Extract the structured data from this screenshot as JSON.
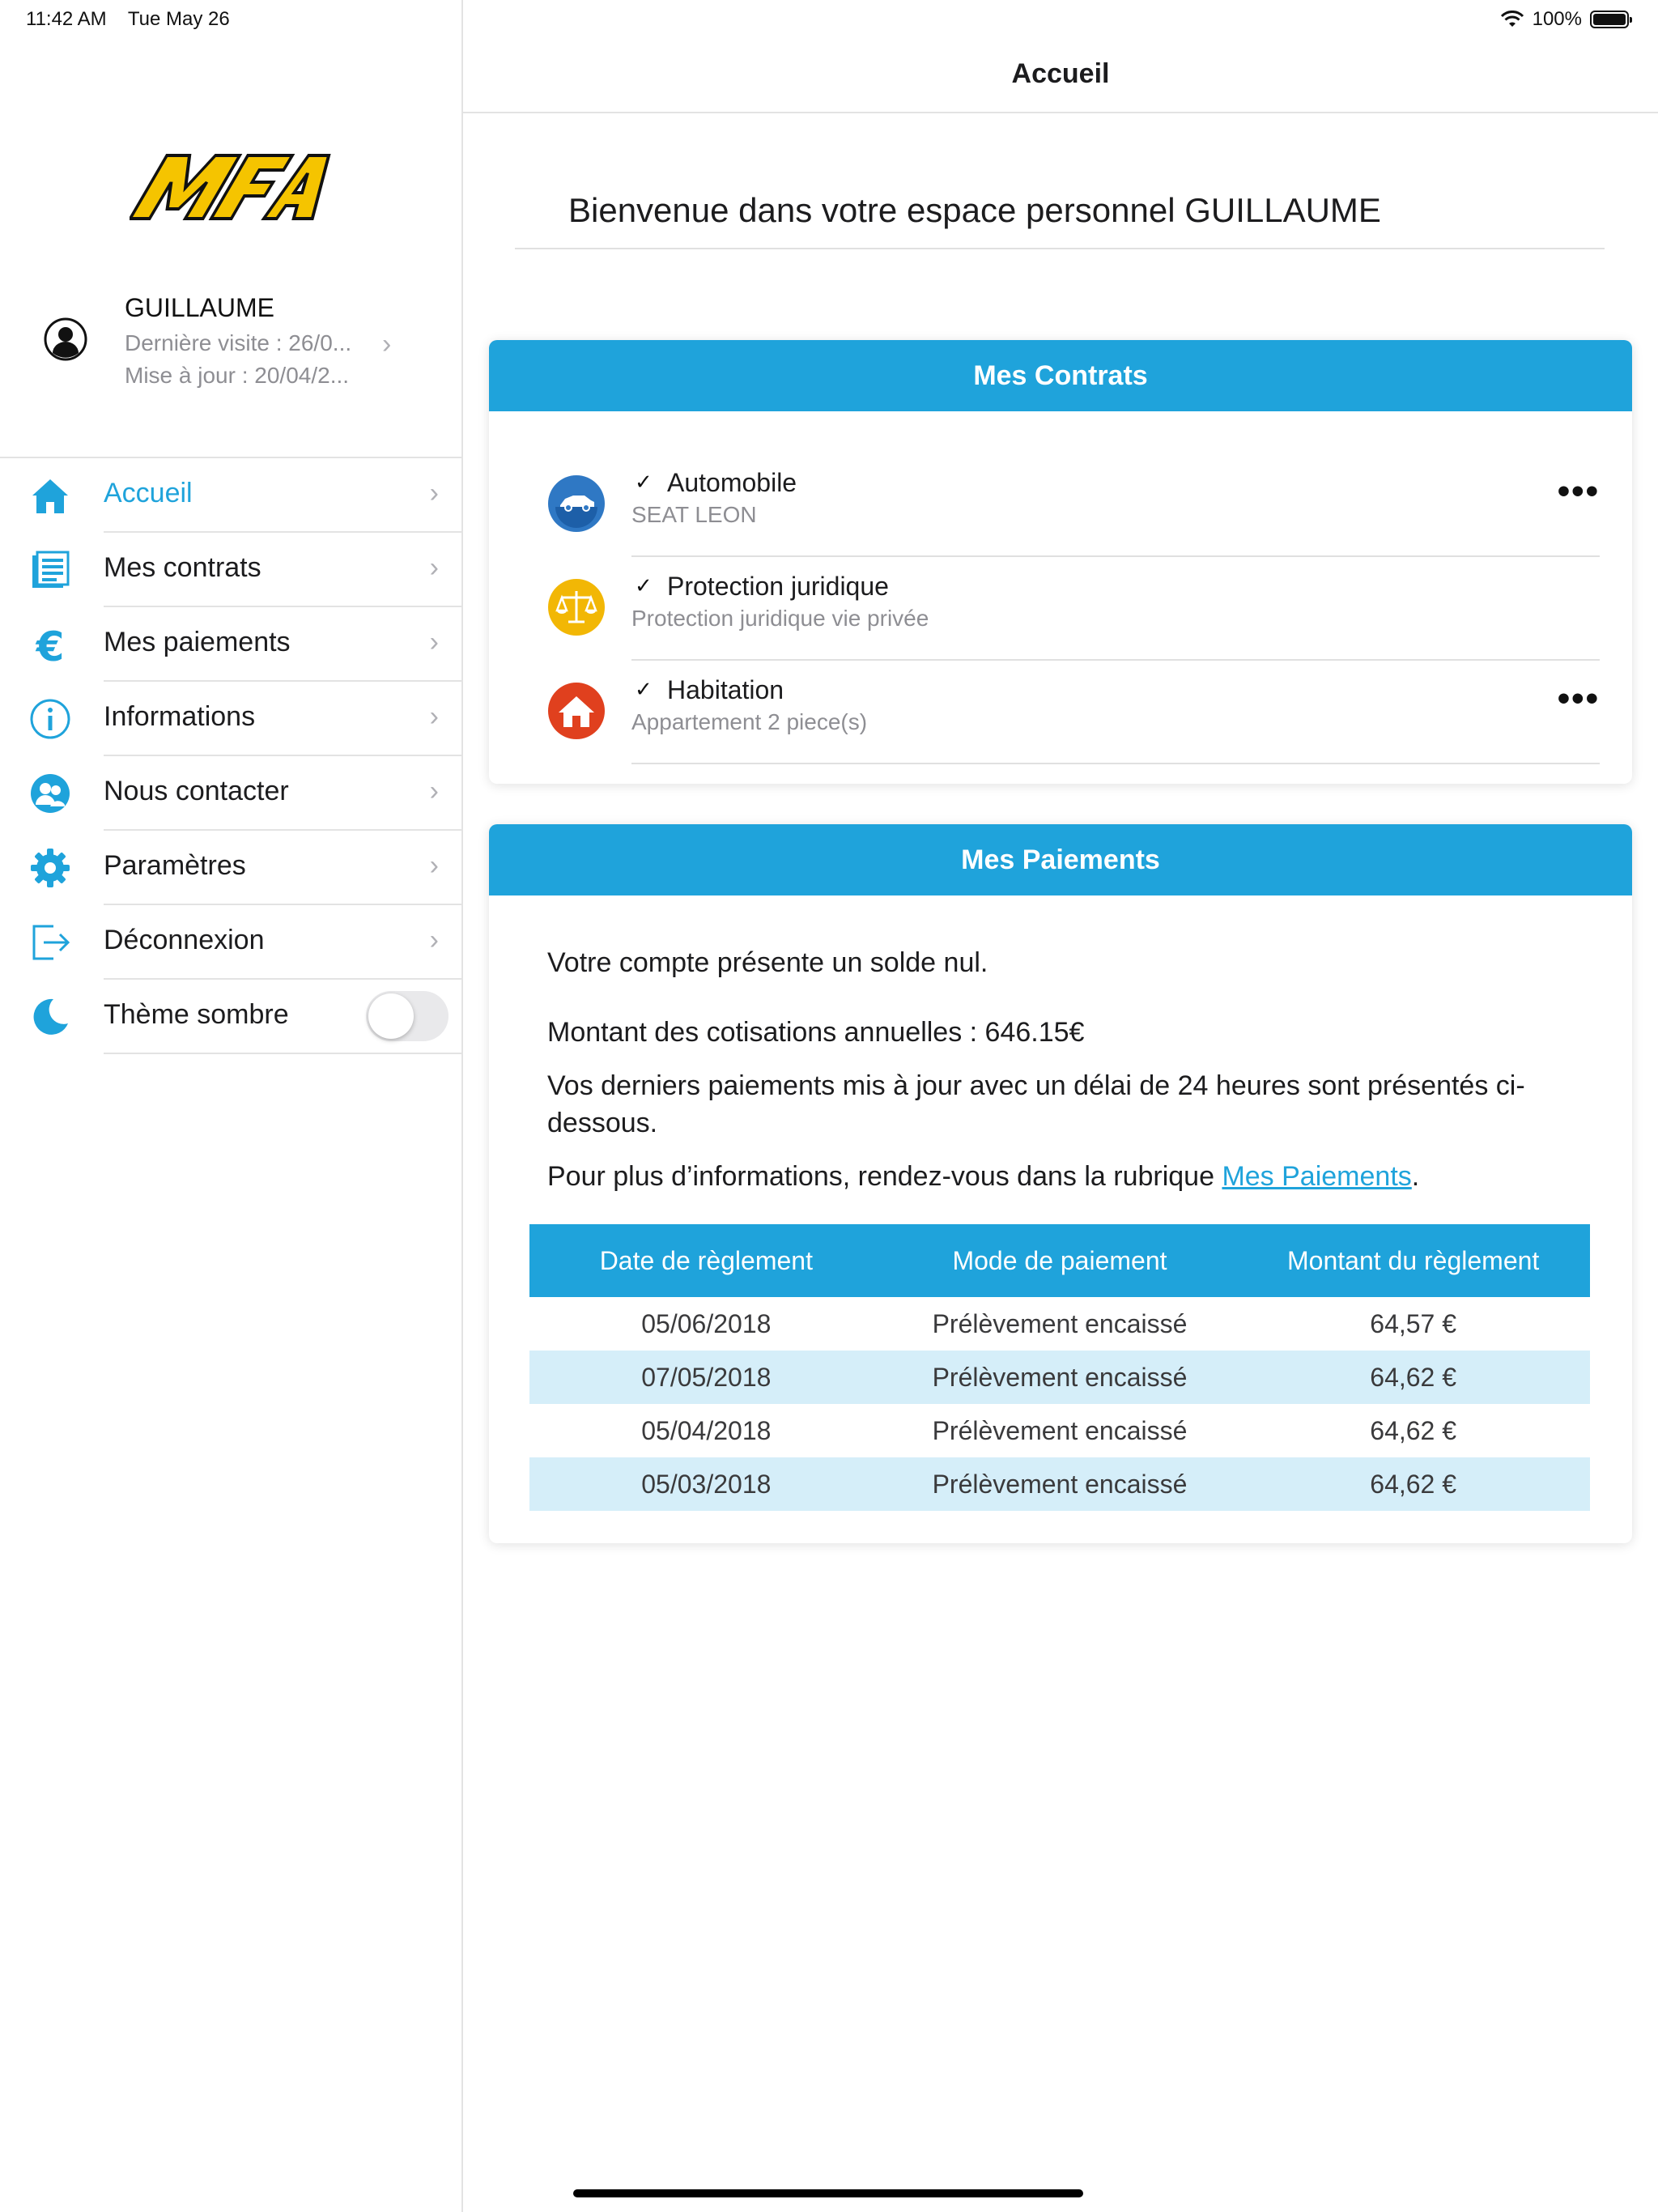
{
  "status_bar": {
    "time": "11:42 AM",
    "date": "Tue May 26",
    "battery_text": "100%",
    "battery_level": 1.0
  },
  "sidebar": {
    "logo_text": "MFA",
    "user": {
      "name": "GUILLAUME",
      "last_visit": "Dernière visite : 26/0...",
      "last_update": "Mise à jour : 20/04/2..."
    },
    "items": [
      {
        "label": "Accueil",
        "icon": "home-icon",
        "active": true
      },
      {
        "label": "Mes contrats",
        "icon": "document-list-icon"
      },
      {
        "label": "Mes paiements",
        "icon": "euro-icon"
      },
      {
        "label": "Informations",
        "icon": "info-icon"
      },
      {
        "label": "Nous contacter",
        "icon": "contact-people-icon"
      },
      {
        "label": "Paramètres",
        "icon": "gear-icon"
      },
      {
        "label": "Déconnexion",
        "icon": "logout-icon"
      },
      {
        "label": "Thème sombre",
        "icon": "moon-icon",
        "toggle": false
      }
    ]
  },
  "main": {
    "nav_title": "Accueil",
    "welcome": "Bienvenue dans votre espace personnel GUILLAUME",
    "contracts": {
      "title": "Mes Contrats",
      "items": [
        {
          "check": "✓",
          "title": "Automobile",
          "subtitle": "SEAT LEON",
          "icon": "car-icon",
          "color": "#2f78c4",
          "more": "•••"
        },
        {
          "check": "✓",
          "title": "Protection juridique",
          "subtitle": "Protection juridique vie privée",
          "icon": "scales-icon",
          "color": "#f2b705"
        },
        {
          "check": "✓",
          "title": "Habitation",
          "subtitle": "Appartement 2 piece(s)",
          "icon": "house-icon",
          "color": "#e0401e",
          "more": "•••"
        }
      ]
    },
    "payments": {
      "title": "Mes Paiements",
      "balance_text": "Votre compte présente un solde nul.",
      "annual_text": "Montant des cotisations annuelles : 646.15€",
      "recent_text": "Vos derniers paiements mis à jour avec un délai de 24 heures sont présentés ci-dessous.",
      "info_text": "Pour plus d’informations, rendez-vous dans la rubrique ",
      "link_text": "Mes Paiements",
      "info_end": ".",
      "table": {
        "headers": [
          "Date de règlement",
          "Mode de paiement",
          "Montant du règlement"
        ],
        "rows": [
          [
            "05/06/2018",
            "Prélèvement encaissé",
            "64,57 €"
          ],
          [
            "07/05/2018",
            "Prélèvement encaissé",
            "64,62 €"
          ],
          [
            "05/04/2018",
            "Prélèvement encaissé",
            "64,62 €"
          ],
          [
            "05/03/2018",
            "Prélèvement encaissé",
            "64,62 €"
          ]
        ]
      }
    }
  },
  "colors": {
    "accent": "#1fa3db",
    "table_alt_row": "#d5eef9"
  }
}
